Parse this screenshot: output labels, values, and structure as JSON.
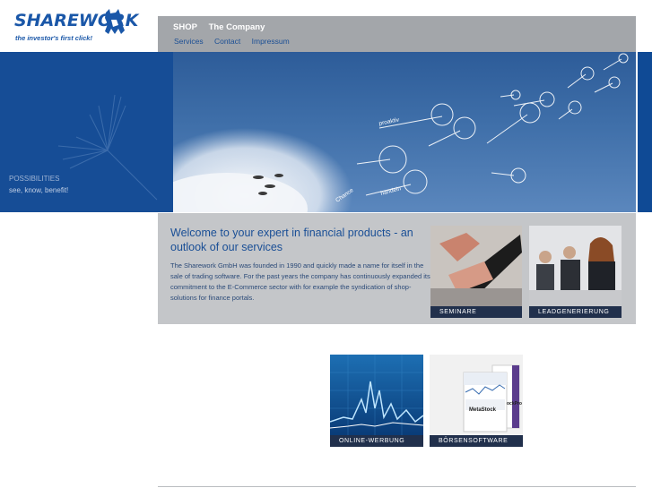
{
  "logo": {
    "wordmark": "SHAREWORK",
    "slogan": "the investor's first click!"
  },
  "nav": {
    "primary": [
      "SHOP",
      "The Company"
    ],
    "secondary": [
      "Services",
      "Contact",
      "Impressum"
    ]
  },
  "hero": {
    "left_title": "POSSIBILITIES",
    "left_subtitle": "see, know, benefit!",
    "seed_words": [
      "proaktiv",
      "Chance",
      "handeln"
    ]
  },
  "welcome": {
    "title": "Welcome to your expert in financial products - an outlook of our services",
    "body": "The Sharework GmbH was founded in 1990 and quickly made a name for itself in the sale of trading software. For the past years the company has continuously expanded its commitment to the E-Commerce sector with for example the syndication of shop-solutions for finance portals."
  },
  "tiles": {
    "seminare": "SEMINARE",
    "lead": "LEADGENERIERUNG",
    "online": "ONLINE-WERBUNG",
    "boerse": "BÖRSENSOFTWARE",
    "product_box_name": "MetaStock",
    "product_box_name_2": "ockPro"
  },
  "colors": {
    "brand_blue": "#164d96",
    "nav_gray": "#a3a6aa",
    "panel_gray": "#c4c6c9",
    "caption_bg": "#21304c"
  }
}
